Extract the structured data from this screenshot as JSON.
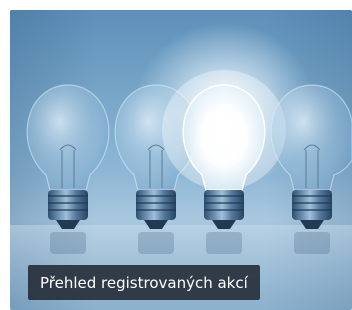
{
  "tile": {
    "caption": "Přehled registrovaných akcí",
    "image_subject": "lightbulbs-image"
  },
  "colors": {
    "caption_background": "#262e38",
    "caption_text": "#ffffff",
    "background_top": "#5d8fb8",
    "background_bottom": "#8eb3cf"
  }
}
